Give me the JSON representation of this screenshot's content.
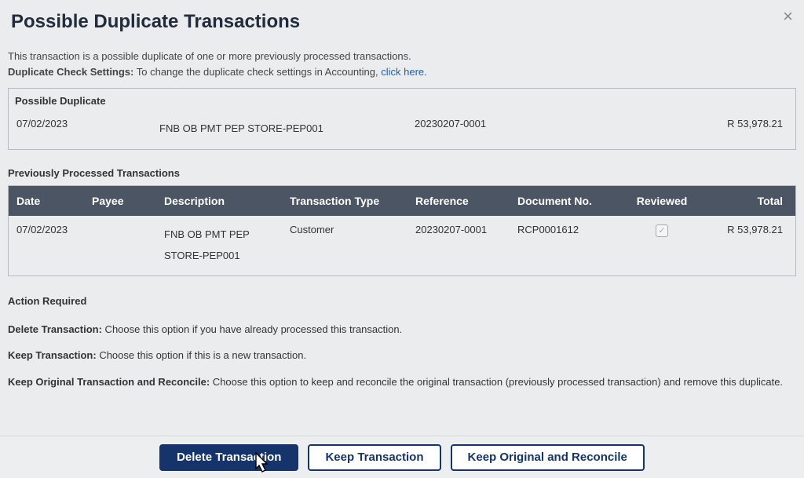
{
  "dialog": {
    "title": "Possible Duplicate Transactions",
    "intro_text": "This transaction is a possible duplicate of one or more previously processed transactions.",
    "settings_label": "Duplicate Check Settings:",
    "settings_text": " To change the duplicate check settings in Accounting, ",
    "settings_link": "click here",
    "settings_tail": "."
  },
  "possible_duplicate": {
    "title": "Possible Duplicate",
    "date": "07/02/2023",
    "description": "FNB OB PMT PEP STORE-PEP001",
    "reference": "20230207-0001",
    "total": "R 53,978.21"
  },
  "previously_processed": {
    "title": "Previously Processed Transactions",
    "headers": {
      "date": "Date",
      "payee": "Payee",
      "description": "Description",
      "type": "Transaction Type",
      "reference": "Reference",
      "document": "Document No.",
      "reviewed": "Reviewed",
      "total": "Total"
    },
    "row": {
      "date": "07/02/2023",
      "payee": "",
      "description": "FNB OB PMT PEP STORE-PEP001",
      "type": "Customer",
      "reference": "20230207-0001",
      "document": "RCP0001612",
      "reviewed": true,
      "total": "R 53,978.21"
    }
  },
  "action_required": {
    "title": "Action Required",
    "delete_label": "Delete Transaction:",
    "delete_text": " Choose this option if you have already processed this transaction.",
    "keep_label": "Keep Transaction:",
    "keep_text": " Choose this option if this is a new transaction.",
    "reconcile_label": "Keep Original Transaction and Reconcile:",
    "reconcile_text": " Choose this option to keep and reconcile the original transaction (previously processed transaction) and remove this duplicate."
  },
  "buttons": {
    "delete": "Delete Transaction",
    "keep": "Keep Transaction",
    "reconcile": "Keep Original and Reconcile"
  }
}
